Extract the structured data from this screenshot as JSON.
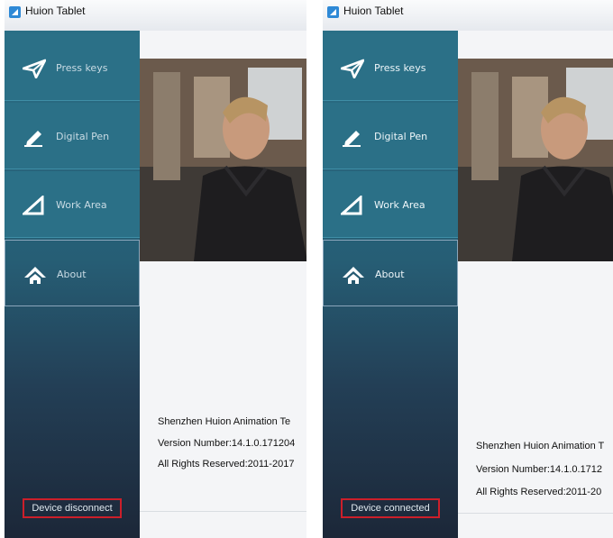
{
  "panels": [
    {
      "title": "Huion Tablet",
      "nav": [
        {
          "label": "Press keys",
          "icon": "paper-plane-icon"
        },
        {
          "label": "Digital Pen",
          "icon": "pen-icon"
        },
        {
          "label": "Work Area",
          "icon": "triangle-icon"
        },
        {
          "label": "About",
          "icon": "home-icon"
        }
      ],
      "status": "Device disconnect",
      "about": {
        "company": "Shenzhen Huion Animation Te",
        "version": "Version Number:14.1.0.171204",
        "rights": "All Rights Reserved:2011-2017"
      }
    },
    {
      "title": "Huion Tablet",
      "nav": [
        {
          "label": "Press keys",
          "icon": "paper-plane-icon"
        },
        {
          "label": "Digital Pen",
          "icon": "pen-icon"
        },
        {
          "label": "Work Area",
          "icon": "triangle-icon"
        },
        {
          "label": "About",
          "icon": "home-icon"
        }
      ],
      "status": "Device connected",
      "about": {
        "company": "Shenzhen Huion Animation T",
        "version": "Version Number:14.1.0.1712",
        "rights": "All Rights Reserved:2011-20"
      }
    }
  ],
  "colors": {
    "sidebar": "#2b7087",
    "highlight_border": "#cc1f2a",
    "window_bg": "#f4f5f7"
  }
}
